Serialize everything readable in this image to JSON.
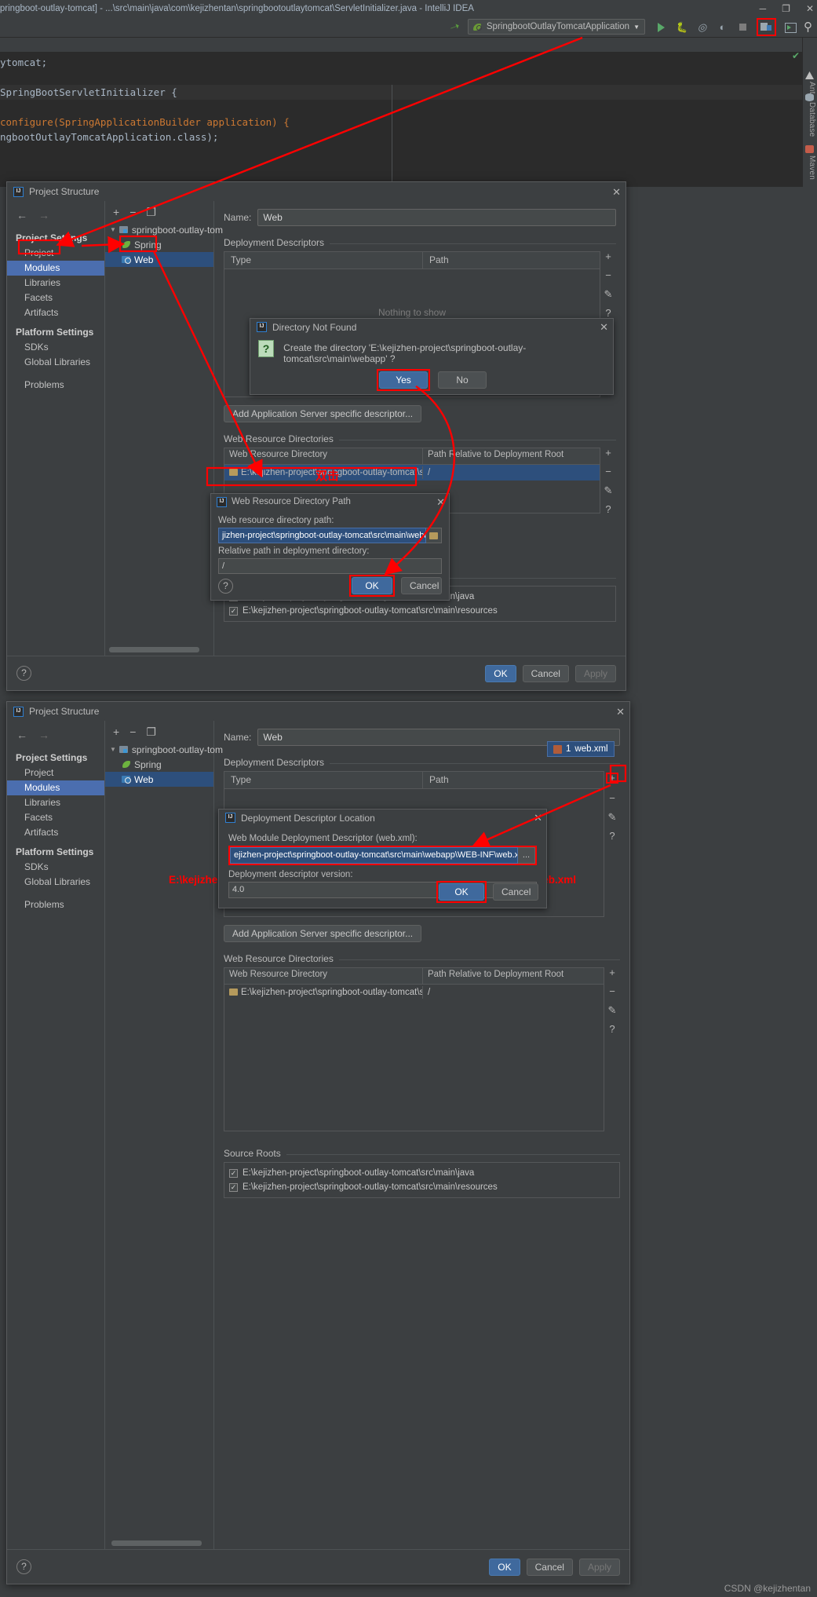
{
  "window": {
    "title": "ct\\springboot-outlay-tomcat] - ...\\src\\main\\java\\com\\kejizhentan\\springbootoutlaytomcat\\ServletInitializer.java - IntelliJ IDEA",
    "minimize": "─",
    "maximize": "❐",
    "close": "✕"
  },
  "toolbar": {
    "run_config": "SpringbootOutlayTomcatApplication",
    "dropdown_caret": "▼",
    "icons": [
      {
        "name": "run-icon",
        "label": "Run"
      },
      {
        "name": "debug-icon",
        "label": "Debug"
      },
      {
        "name": "run-with-coverage-icon",
        "label": "Run with Coverage"
      },
      {
        "name": "profiler-icon",
        "label": "Profiler"
      },
      {
        "name": "stop-icon",
        "label": "Stop"
      },
      {
        "name": "project-structure-icon",
        "label": "Project Structure"
      },
      {
        "name": "select-target-icon",
        "label": "Select Target"
      },
      {
        "name": "search-everywhere-icon",
        "label": "Search Everywhere"
      }
    ]
  },
  "editor": {
    "lines": [
      "ytomcat;",
      "",
      "SpringBootServletInitializer {",
      "",
      "configure(SpringApplicationBuilder application) {",
      "ngbootOutlayTomcatApplication.class);"
    ],
    "ok_check": "✔"
  },
  "right_tool_strip": [
    "Ant",
    "Database",
    "Maven"
  ],
  "dialog1": {
    "title": "Project Structure",
    "close": "✕",
    "nav": {
      "back": "←",
      "forward": "→"
    },
    "sidebar": {
      "group1": "Project Settings",
      "items1": [
        "Project",
        "Modules",
        "Libraries",
        "Facets",
        "Artifacts"
      ],
      "selected1": "Modules",
      "group2": "Platform Settings",
      "items2": [
        "SDKs",
        "Global Libraries"
      ],
      "items3": [
        "Problems"
      ]
    },
    "tree": {
      "tools": {
        "add": "+",
        "remove": "−",
        "copy": "❐"
      },
      "nodes": [
        {
          "label": "springboot-outlay-tom",
          "icon": "module-icon",
          "expander": "▼",
          "selected": false
        },
        {
          "label": "Spring",
          "icon": "spring-icon",
          "expander": "",
          "selected": false
        },
        {
          "label": "Web",
          "icon": "web-icon",
          "expander": "",
          "selected": true
        }
      ]
    },
    "name_label": "Name:",
    "name_value": "Web",
    "deployment_descriptors": {
      "section_title": "Deployment Descriptors",
      "columns": [
        "Type",
        "Path"
      ],
      "empty_text": "Nothing to show",
      "side_buttons": [
        "+",
        "−",
        "✎",
        "?"
      ]
    },
    "add_app_server_btn": "Add Application Server specific descriptor...",
    "web_resource_directories": {
      "section_title": "Web Resource Directories",
      "columns": [
        "Web Resource Directory",
        "Path Relative to Deployment Root"
      ],
      "rows": [
        {
          "dir": "E:\\kejizhen-project\\springboot-outlay-tomcat\\src\\...",
          "path": "/"
        }
      ],
      "side_buttons": [
        "+",
        "−",
        "✎",
        "?"
      ]
    },
    "source_roots": {
      "section_title": "Source Roots",
      "items": [
        {
          "checked": true,
          "path": "E:\\kejizhen-project\\springboot-outlay-tomcat\\src\\main\\java"
        },
        {
          "checked": true,
          "path": "E:\\kejizhen-project\\springboot-outlay-tomcat\\src\\main\\resources"
        }
      ],
      "check_glyph": "✓"
    },
    "footer": {
      "help": "?",
      "ok": "OK",
      "cancel": "Cancel",
      "apply": "Apply"
    }
  },
  "directory_not_found": {
    "title": "Directory Not Found",
    "close": "✕",
    "icon_glyph": "?",
    "message": "Create the directory 'E:\\kejizhen-project\\springboot-outlay-tomcat\\src\\main\\webapp' ?",
    "yes": "Yes",
    "no": "No"
  },
  "web_resource_dir_path": {
    "title": "Web Resource Directory Path",
    "close": "✕",
    "path_label": "Web resource directory path:",
    "path_value": "jizhen-project\\springboot-outlay-tomcat\\src\\main\\webapp",
    "relative_label": "Relative path in deployment directory:",
    "relative_value": "/",
    "help": "?",
    "ok": "OK",
    "cancel": "Cancel"
  },
  "dialog2": {
    "title": "Project Structure",
    "close": "✕",
    "nav": {
      "back": "←",
      "forward": "→"
    },
    "sidebar": {
      "group1": "Project Settings",
      "items1": [
        "Project",
        "Modules",
        "Libraries",
        "Facets",
        "Artifacts"
      ],
      "selected1": "Modules",
      "group2": "Platform Settings",
      "items2": [
        "SDKs",
        "Global Libraries"
      ],
      "items3": [
        "Problems"
      ]
    },
    "tree": {
      "tools": {
        "add": "+",
        "remove": "−",
        "copy": "❐"
      },
      "nodes": [
        {
          "label": "springboot-outlay-tom",
          "icon": "module-icon",
          "expander": "▼",
          "selected": false
        },
        {
          "label": "Spring",
          "icon": "spring-icon",
          "expander": "",
          "selected": false
        },
        {
          "label": "Web",
          "icon": "web-icon",
          "expander": "",
          "selected": true
        }
      ]
    },
    "name_label": "Name:",
    "name_value": "Web",
    "deployment_descriptors": {
      "section_title": "Deployment Descriptors",
      "columns": [
        "Type",
        "Path"
      ],
      "side_buttons": [
        "+",
        "−",
        "✎",
        "?"
      ]
    },
    "webxml_badge": {
      "index": "1",
      "label": "web.xml"
    },
    "add_app_server_btn": "Add Application Server specific descriptor...",
    "web_resource_directories": {
      "section_title": "Web Resource Directories",
      "columns": [
        "Web Resource Directory",
        "Path Relative to Deployment Root"
      ],
      "rows": [
        {
          "dir": "E:\\kejizhen-project\\springboot-outlay-tomcat\\src\\...",
          "path": "/"
        }
      ],
      "side_buttons": [
        "+",
        "−",
        "✎",
        "?"
      ]
    },
    "source_roots": {
      "section_title": "Source Roots",
      "items": [
        {
          "checked": true,
          "path": "E:\\kejizhen-project\\springboot-outlay-tomcat\\src\\main\\java"
        },
        {
          "checked": true,
          "path": "E:\\kejizhen-project\\springboot-outlay-tomcat\\src\\main\\resources"
        }
      ],
      "check_glyph": "✓"
    },
    "footer": {
      "help": "?",
      "ok": "OK",
      "cancel": "Cancel",
      "apply": "Apply"
    }
  },
  "deployment_descriptor_location": {
    "title": "Deployment Descriptor Location",
    "close": "✕",
    "label": "Web Module Deployment Descriptor (web.xml):",
    "value": "ejizhen-project\\springboot-outlay-tomcat\\src\\main\\webapp\\WEB-INF\\web.xml",
    "version_label": "Deployment descriptor version:",
    "version_value": "4.0",
    "browse": "...",
    "ok": "OK",
    "cancel": "Cancel"
  },
  "annotations": {
    "double_click_cn": "双击",
    "webxml_path": "E:\\kejizhen-project\\springboot-outlay-tomcat\\src\\main\\webapp\\WEB-INF\\web.xml",
    "color": "#ff0000"
  },
  "watermark": "CSDN @kejizhentan"
}
